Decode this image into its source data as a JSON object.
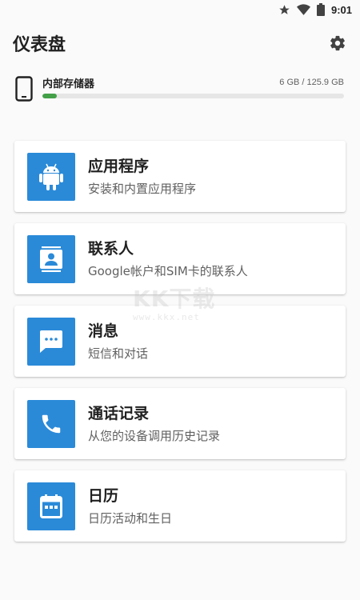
{
  "status_bar": {
    "time": "9:01",
    "icons": [
      "star-icon",
      "wifi-icon",
      "battery-icon"
    ]
  },
  "header": {
    "title": "仪表盘",
    "settings_icon": "gear-icon"
  },
  "storage": {
    "label": "内部存储器",
    "size_text": "6 GB / 125.9 GB",
    "used_gb": 6,
    "total_gb": 125.9,
    "used_fraction": 0.0477,
    "bar_color": "#43a047"
  },
  "cards": [
    {
      "title": "应用程序",
      "subtitle": "安装和内置应用程序",
      "icon": "android-icon"
    },
    {
      "title": "联系人",
      "subtitle": "Google帐户和SIM卡的联系人",
      "icon": "contacts-icon"
    },
    {
      "title": "消息",
      "subtitle": "短信和对话",
      "icon": "message-icon"
    },
    {
      "title": "通话记录",
      "subtitle": "从您的设备调用历史记录",
      "icon": "phone-icon"
    },
    {
      "title": "日历",
      "subtitle": "日历活动和生日",
      "icon": "calendar-icon"
    }
  ],
  "accent_color": "#2a8ad8",
  "watermark": {
    "logo": "KK下载",
    "url": "www.kkx.net"
  }
}
